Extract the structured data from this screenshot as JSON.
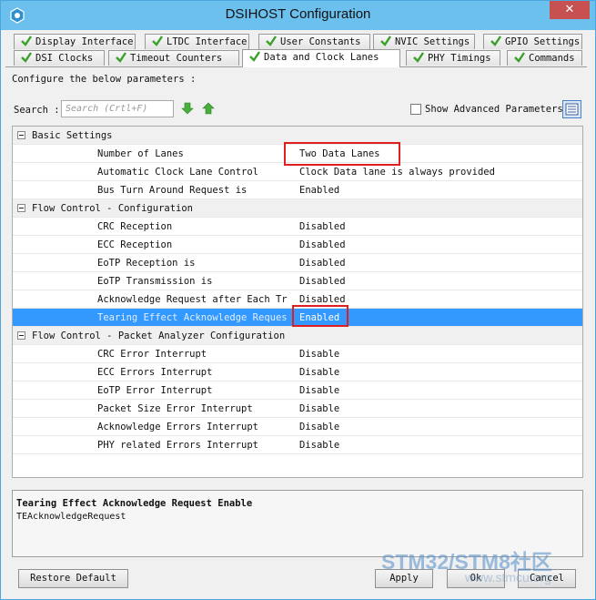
{
  "window": {
    "title": "DSIHOST Configuration",
    "close_glyph": "✕"
  },
  "tabs": {
    "row1": [
      {
        "label": "Display Interface"
      },
      {
        "label": "LTDC Interface"
      },
      {
        "label": "User Constants"
      },
      {
        "label": "NVIC Settings"
      },
      {
        "label": "GPIO Settings"
      }
    ],
    "row2": [
      {
        "label": "DSI Clocks"
      },
      {
        "label": "Timeout Counters"
      },
      {
        "label": "Data and Clock Lanes",
        "active": true
      },
      {
        "label": "PHY Timings"
      },
      {
        "label": "Commands"
      }
    ],
    "check_color": "#3aa02a"
  },
  "toolbar": {
    "configure_label": "Configure the below parameters :",
    "search_label": "Search :",
    "search_placeholder": "Search (Crtl+F)",
    "show_advanced_label": "Show Advanced Parameters"
  },
  "tree": {
    "groups": [
      {
        "label": "Basic Settings",
        "params": [
          {
            "name": "Number of Lanes",
            "value": "Two Data Lanes"
          },
          {
            "name": "Automatic Clock Lane Control",
            "value": "Clock Data lane is always provided"
          },
          {
            "name": "Bus Turn Around Request is",
            "value": "Enabled"
          }
        ]
      },
      {
        "label": "Flow Control - Configuration",
        "params": [
          {
            "name": "CRC Reception",
            "value": "Disabled"
          },
          {
            "name": "ECC Reception",
            "value": "Disabled"
          },
          {
            "name": "EoTP Reception is",
            "value": "Disabled"
          },
          {
            "name": "EoTP Transmission is",
            "value": "Disabled"
          },
          {
            "name": "Acknowledge Request after Each Tr...",
            "value": "Disabled"
          },
          {
            "name": "Tearing Effect Acknowledge Reques...",
            "value": "Enabled",
            "selected": true
          }
        ]
      },
      {
        "label": "Flow Control - Packet Analyzer Configuration",
        "params": [
          {
            "name": "CRC Error Interrupt",
            "value": "Disable"
          },
          {
            "name": "ECC Errors Interrupt",
            "value": "Disable"
          },
          {
            "name": "EoTP Error Interrupt",
            "value": "Disable"
          },
          {
            "name": "Packet Size Error Interrupt",
            "value": "Disable"
          },
          {
            "name": "Acknowledge Errors Interrupt",
            "value": "Disable"
          },
          {
            "name": "PHY related Errors Interrupt",
            "value": "Disable"
          }
        ]
      }
    ]
  },
  "description": {
    "title": "Tearing Effect Acknowledge Request Enable",
    "body": "TEAcknowledgeRequest"
  },
  "buttons": {
    "restore_default": "Restore Default",
    "apply": "Apply",
    "ok": "Ok",
    "cancel": "Cancel"
  },
  "watermark": {
    "line1": "STM32/STM8社区",
    "line2": "www.stmcu.org"
  },
  "colors": {
    "titlebar": "#6cc0ee",
    "selection": "#3399ff",
    "highlight_box": "#e02020",
    "close": "#c75050"
  }
}
